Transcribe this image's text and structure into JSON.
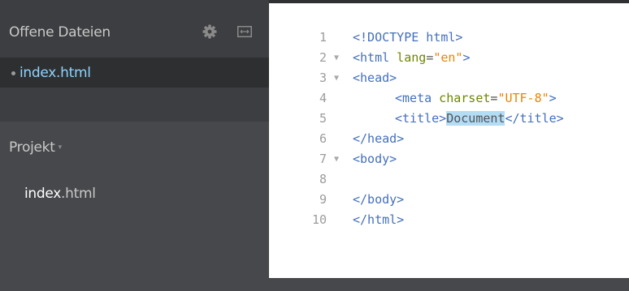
{
  "sidebar": {
    "open_files_title": "Offene Dateien",
    "open_file": "index.html",
    "project_title": "Projekt",
    "project_caret": "▾",
    "tree_file_base": "index",
    "tree_file_ext": ".html"
  },
  "editor": {
    "lines": [
      {
        "num": "1",
        "fold": "",
        "parts": {
          "a": "<!DOCTYPE html>"
        }
      },
      {
        "num": "2",
        "fold": "▼",
        "parts": {
          "t1": "<html",
          "a1": " lang",
          "eq": "=",
          "s1": "\"en\"",
          "t2": ">"
        }
      },
      {
        "num": "3",
        "fold": "▼",
        "parts": {
          "t1": "<head>"
        }
      },
      {
        "num": "4",
        "fold": "",
        "parts": {
          "t1": "<meta",
          "a1": " charset",
          "eq": "=",
          "s1": "\"UTF-8\"",
          "t2": ">"
        }
      },
      {
        "num": "5",
        "fold": "",
        "parts": {
          "t1": "<title>",
          "sel": "Document",
          "t2": "</title>"
        }
      },
      {
        "num": "6",
        "fold": "",
        "parts": {
          "t1": "</head>"
        }
      },
      {
        "num": "7",
        "fold": "▼",
        "parts": {
          "t1": "<body>"
        }
      },
      {
        "num": "8",
        "fold": "",
        "parts": {}
      },
      {
        "num": "9",
        "fold": "",
        "parts": {
          "t1": "</body>"
        }
      },
      {
        "num": "10",
        "fold": "",
        "parts": {
          "t1": "</html>"
        }
      }
    ]
  },
  "colors": {
    "sidebar_bg": "#47484b",
    "selected_file_bg": "#2e2f31",
    "selected_file_text": "#8fd3ff",
    "tag": "#446fbd",
    "attribute": "#6d8600",
    "string": "#e88501",
    "selection": "#b3dcf5"
  }
}
